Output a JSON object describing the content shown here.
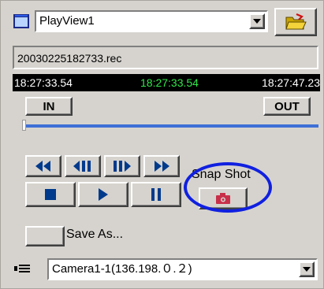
{
  "header": {
    "view_select_value": "PlayView1"
  },
  "recording": {
    "filename": "20030225182733.rec",
    "time_start": "18:27:33.54",
    "time_current": "18:27:33.54",
    "time_end": "18:27:47.23"
  },
  "markers": {
    "in_label": "IN",
    "out_label": "OUT"
  },
  "slider": {
    "position_fraction": 0.0
  },
  "transport": {
    "buttons": [
      "rewind",
      "step-back",
      "step-forward",
      "fast-forward",
      "stop",
      "play",
      "pause"
    ]
  },
  "snapshot": {
    "label": "Snap Shot"
  },
  "save": {
    "label": "Save As..."
  },
  "camera": {
    "select_value": "Camera1-1(136.198.０.２)"
  },
  "colors": {
    "current_time": "#2fe84a",
    "slider": "#3e6fd6",
    "transport_icon": "#003a8c",
    "snapshot_icon": "#c8304a",
    "highlight_ring": "#1020e0"
  }
}
